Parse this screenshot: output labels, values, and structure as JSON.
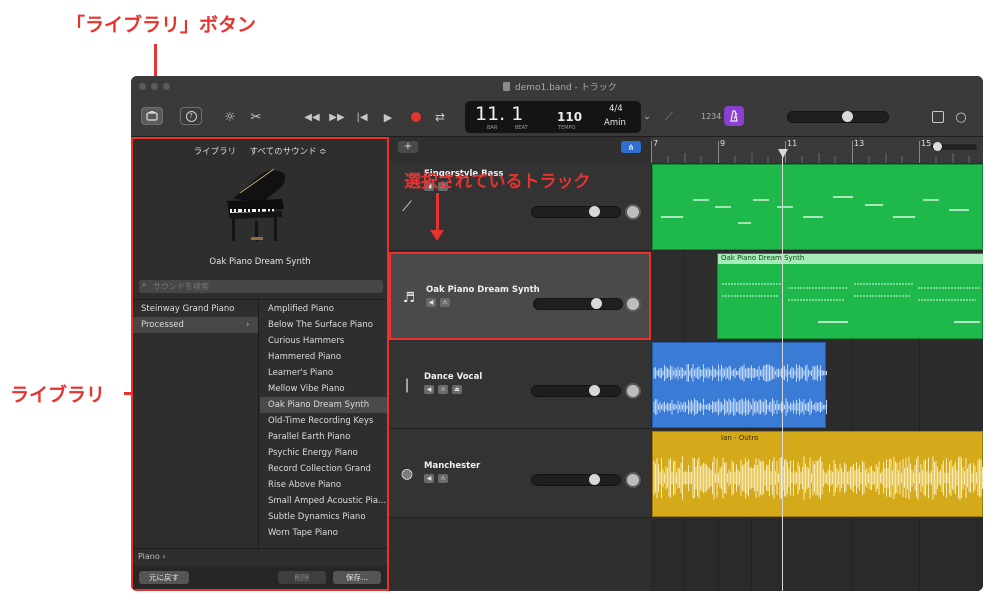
{
  "annotations": {
    "library_button": "「ライブラリ」ボタン",
    "selected_track": "選択されているトラック",
    "library": "ライブラリ"
  },
  "window": {
    "title": "demo1.band - トラック"
  },
  "toolbar": {
    "lcd": {
      "bar_beat": "11. 1",
      "bar_label": "BAR",
      "beat_label": "BEAT",
      "tempo": "110",
      "tempo_label": "TEMPO",
      "time_signature": "4/4",
      "key": "Amin"
    },
    "count_in": "1234",
    "master_volume_fraction": 0.6
  },
  "library": {
    "breadcrumb_root": "ライブラリ",
    "breadcrumb_current": "すべてのサウンド ≎",
    "preset_name": "Oak Piano Dream Synth",
    "search_placeholder": "サウンドを検索",
    "categories": [
      "Steinway Grand Piano",
      "Processed"
    ],
    "presets": [
      "Amplified Piano",
      "Below The Surface Piano",
      "Curious Hammers",
      "Hammered Piano",
      "Learner's Piano",
      "Mellow Vibe Piano",
      "Oak Piano Dream Synth",
      "Old-Time Recording Keys",
      "Parallel Earth Piano",
      "Psychic Energy Piano",
      "Record Collection Grand",
      "Rise Above Piano",
      "Small Amped Acoustic Pia...",
      "Subtle Dynamics Piano",
      "Worn Tape Piano"
    ],
    "footer_path": "Piano ›",
    "revert_label": "元に戻す",
    "delete_label": "削除",
    "save_label": "保存..."
  },
  "tracks": {
    "add_label": "+",
    "items": [
      {
        "name": "Fingerstyle Bass",
        "volume": 0.72
      },
      {
        "name": "Oak Piano Dream Synth",
        "volume": 0.72
      },
      {
        "name": "Dance Vocal",
        "volume": 0.72
      },
      {
        "name": "Manchester",
        "volume": 0.72
      }
    ]
  },
  "timeline": {
    "ruler": [
      "7",
      "9",
      "11",
      "13",
      "15"
    ],
    "regions": {
      "piano_region_name": "Oak Piano Dream Synth",
      "drum_region_name": "Ian - Outro"
    }
  },
  "colors": {
    "midi_region": "#1fb84a",
    "audio_region": "#3a7bd5",
    "drummer_region": "#d4a91a",
    "accent_red": "#e8322e",
    "metronome": "#8a3fd1"
  }
}
